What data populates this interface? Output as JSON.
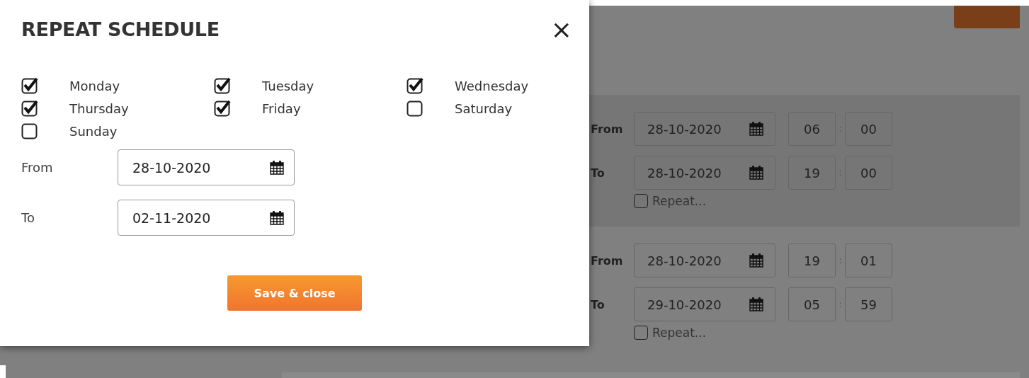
{
  "dialog": {
    "title": "REPEAT SCHEDULE",
    "close": "×",
    "days": [
      {
        "label": "Monday",
        "checked": true
      },
      {
        "label": "Tuesday",
        "checked": true
      },
      {
        "label": "Wednesday",
        "checked": true
      },
      {
        "label": "Thursday",
        "checked": true
      },
      {
        "label": "Friday",
        "checked": true
      },
      {
        "label": "Saturday",
        "checked": false
      },
      {
        "label": "Sunday",
        "checked": false
      }
    ],
    "range": [
      {
        "label": "From",
        "value": "28-10-2020"
      },
      {
        "label": "To",
        "value": "02-11-2020"
      }
    ],
    "button": "Save & close"
  },
  "background_schedule": [
    {
      "rows": [
        {
          "label": "From",
          "date": "28-10-2020",
          "hour": "06",
          "separator": ":",
          "minute": "00"
        },
        {
          "label": "To",
          "date": "28-10-2020",
          "hour": "19",
          "separator": ":",
          "minute": "00"
        }
      ],
      "repeat": {
        "label": "Repeat...",
        "checked": false
      }
    },
    {
      "rows": [
        {
          "label": "From",
          "date": "28-10-2020",
          "hour": "19",
          "separator": ":",
          "minute": "01"
        },
        {
          "label": "To",
          "date": "29-10-2020",
          "hour": "05",
          "separator": ":",
          "minute": "59"
        }
      ],
      "repeat": {
        "label": "Repeat...",
        "checked": false
      }
    }
  ]
}
